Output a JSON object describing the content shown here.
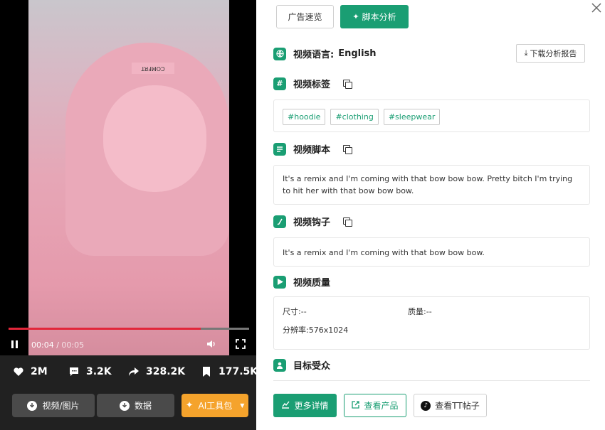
{
  "video": {
    "hoodie_text": "COMFRT",
    "time_current": "00:04",
    "time_total": "00:05",
    "time_sep": " / ",
    "progress_fraction": 0.8
  },
  "stats": {
    "likes": "2M",
    "comments": "3.2K",
    "shares": "328.2K",
    "saves": "177.5K"
  },
  "left_buttons": {
    "media": "视频/图片",
    "data": "数据",
    "ai": "AI工具包"
  },
  "tabs": {
    "overview": "广告速览",
    "script_analysis": "脚本分析"
  },
  "language": {
    "label": "视频语言:",
    "value": "English"
  },
  "download_report": "下载分析报告",
  "tags_section": {
    "title": "视频标签",
    "tags": [
      "#hoodie",
      "#clothing",
      "#sleepwear"
    ]
  },
  "script_section": {
    "title": "视频脚本",
    "text": "It's a remix and I'm coming with that bow bow bow. Pretty bitch I'm trying to hit her with that bow bow bow."
  },
  "hook_section": {
    "title": "视频钩子",
    "text": "It's a remix and I'm coming with that bow bow bow."
  },
  "quality_section": {
    "title": "视频质量",
    "size_label": "尺寸:",
    "size_value": "--",
    "quality_label": "质量:",
    "quality_value": "--",
    "resolution_label": "分辨率:",
    "resolution_value": "576x1024"
  },
  "audience_section": {
    "title": "目标受众"
  },
  "bottom_buttons": {
    "more": "更多详情",
    "product": "查看产品",
    "tt": "查看TT帖子"
  },
  "colors": {
    "accent": "#1a9e73",
    "orange": "#f5a32c",
    "progress": "#e2263a"
  }
}
